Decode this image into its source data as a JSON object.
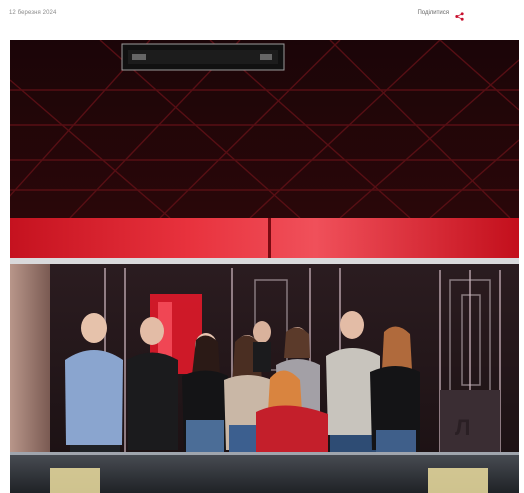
{
  "meta": {
    "date": "12 березня 2024",
    "share_label": "Поділитися",
    "share_icon": "share-icon",
    "accent_color": "#c8102e"
  },
  "photo": {
    "alt": "",
    "people_count": 11
  }
}
